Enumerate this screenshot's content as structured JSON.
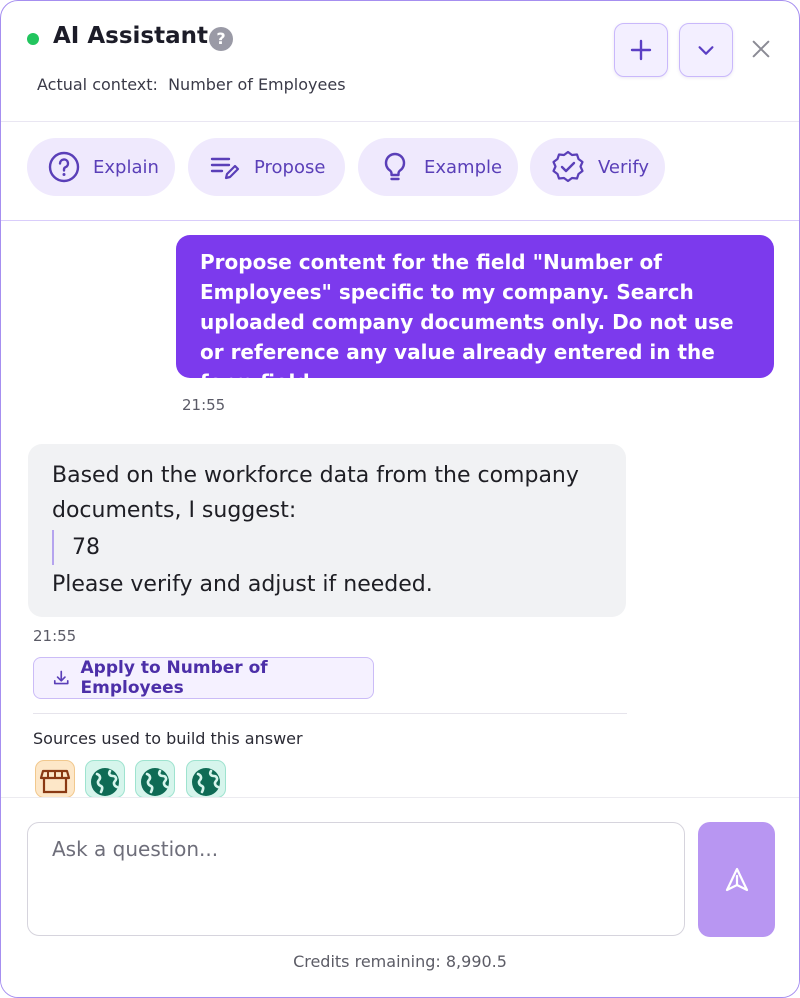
{
  "header": {
    "title": "AI Assistant",
    "help_icon": "question-circle-icon",
    "context_label": "Actual context:",
    "context_value": "Number of Employees",
    "status_color": "#22c55e"
  },
  "actions": [
    {
      "label": "Explain",
      "icon": "question-circle-icon"
    },
    {
      "label": "Propose",
      "icon": "edit-lines-icon"
    },
    {
      "label": "Example",
      "icon": "lightbulb-icon"
    },
    {
      "label": "Verify",
      "icon": "badge-check-icon"
    }
  ],
  "messages": {
    "user": {
      "text": "Propose content for the field \"Number of Employees\" specific to my company. Search uploaded company documents only. Do not use or reference any value already entered in the form field.",
      "time": "21:55"
    },
    "assistant": {
      "intro": "Based on the workforce data from the company documents, I suggest:",
      "value": "78",
      "outro": "Please verify and adjust if needed.",
      "time": "21:55"
    }
  },
  "apply_button": "Apply to Number of Employees",
  "sources": {
    "label": "Sources used to build this answer",
    "items": [
      "store-icon",
      "globe-icon",
      "globe-icon",
      "globe-icon"
    ]
  },
  "composer": {
    "placeholder": "Ask a question...",
    "credits": "Credits remaining: 8,990.5"
  },
  "colors": {
    "accent": "#7c3aed",
    "chip_bg": "#efe9fd",
    "send_bg": "#b896f2"
  }
}
